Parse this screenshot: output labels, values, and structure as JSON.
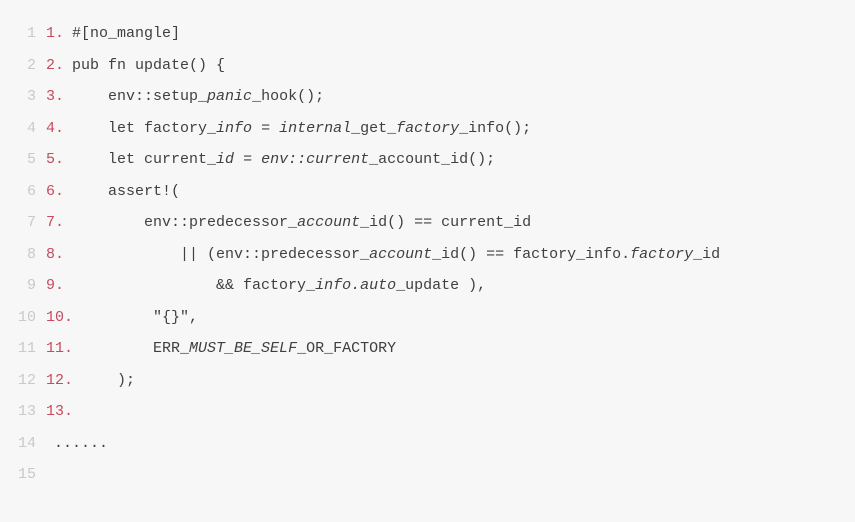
{
  "code": {
    "lines": [
      {
        "gutter": "1",
        "ordinal": "1.",
        "html": "#[no_mangle]"
      },
      {
        "gutter": "2",
        "ordinal": "2.",
        "html": "pub fn update() {"
      },
      {
        "gutter": "3",
        "ordinal": "3.",
        "html": "    env::setup_<em>panic</em>_hook();"
      },
      {
        "gutter": "4",
        "ordinal": "4.",
        "html": "    let factory_<em>info</em> = <em>internal</em>_get_<em>factory</em>_info();"
      },
      {
        "gutter": "5",
        "ordinal": "5.",
        "html": "    let current_<em>id</em> = <em>env::current</em>_account_id();"
      },
      {
        "gutter": "6",
        "ordinal": "6.",
        "html": "    assert!("
      },
      {
        "gutter": "7",
        "ordinal": "7.",
        "html": "        env::predecessor_<em>account</em>_id() == current_id"
      },
      {
        "gutter": "8",
        "ordinal": "8.",
        "html": "            || (env::predecessor_<em>account</em>_id() == factory_info.<em>factory</em>_id"
      },
      {
        "gutter": "9",
        "ordinal": "9.",
        "html": "                && factory_<em>info.auto</em>_update ),"
      },
      {
        "gutter": "10",
        "ordinal": "10.",
        "html": "        \"{}\","
      },
      {
        "gutter": "11",
        "ordinal": "11.",
        "html": "        ERR_<em>MUST_BE_SELF</em>_OR_FACTORY"
      },
      {
        "gutter": "12",
        "ordinal": "12.",
        "html": "    );"
      },
      {
        "gutter": "13",
        "ordinal": "13.",
        "html": ""
      },
      {
        "gutter": "14",
        "ordinal": "",
        "html": "......"
      },
      {
        "gutter": "15",
        "ordinal": "",
        "html": ""
      }
    ]
  }
}
